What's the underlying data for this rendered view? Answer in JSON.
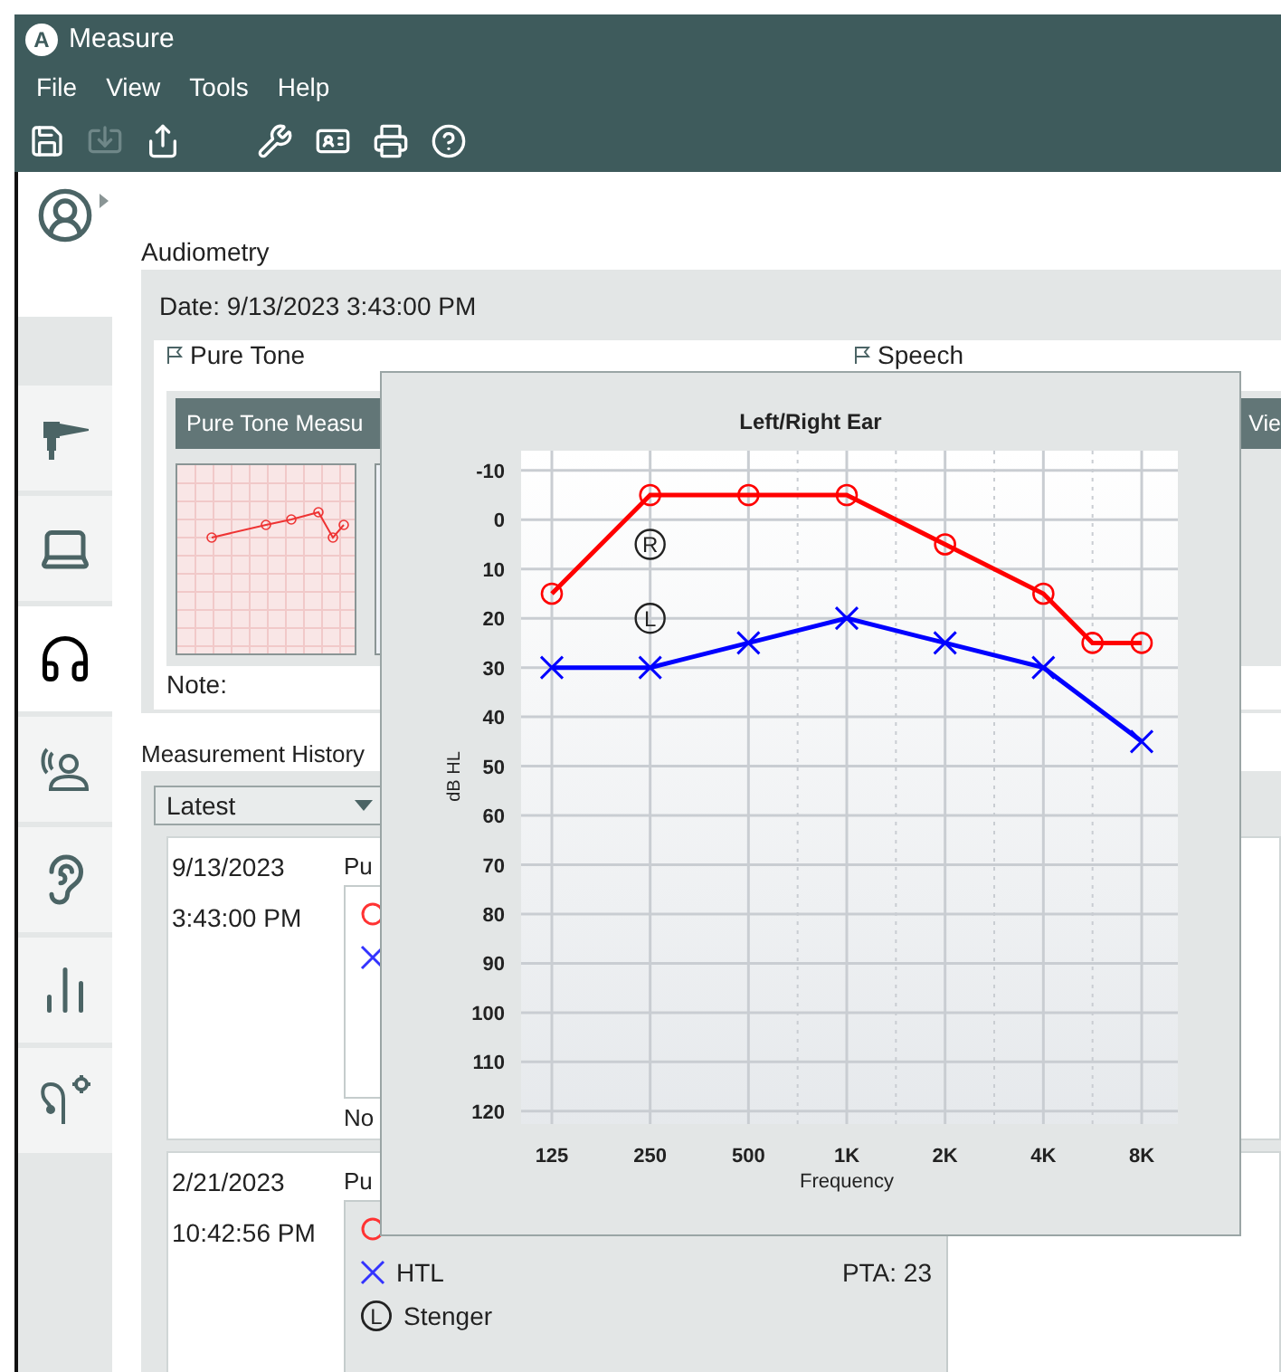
{
  "window": {
    "title": "Measure",
    "logo": "A"
  },
  "menu": [
    "File",
    "View",
    "Tools",
    "Help"
  ],
  "toolbar": [
    {
      "disabled": false
    },
    {
      "disabled": true
    },
    {
      "disabled": false
    },
    {
      "disabled": false
    },
    {
      "disabled": false
    },
    {
      "disabled": false
    },
    {
      "disabled": false
    }
  ],
  "sidebar": {
    "items": [
      {
        "selected": false
      },
      {
        "selected": false
      },
      {
        "selected": true
      },
      {
        "selected": false
      },
      {
        "selected": false
      },
      {
        "selected": false
      },
      {
        "selected": false
      }
    ]
  },
  "audiometry": {
    "heading": "Audiometry",
    "date": "Date: 9/13/2023 3:43:00 PM",
    "sections": [
      {
        "label": "Pure Tone"
      },
      {
        "label": "Speech"
      }
    ],
    "header": "Pure Tone Measu",
    "header_right": "Vie",
    "note": "Note:"
  },
  "history": {
    "heading": "Measurement History",
    "filter": "Latest",
    "cards": [
      {
        "date": "9/13/2023",
        "time": "3:43:00 PM",
        "title": "Pu",
        "note": "No",
        "entries": [
          {
            "kind": "circle",
            "color": "#ff3333"
          },
          {
            "kind": "cross",
            "color": "#3333ff"
          }
        ]
      },
      {
        "date": "2/21/2023",
        "time": "10:42:56 PM",
        "title": "Pu",
        "entries": [
          {
            "kind": "circle",
            "color": "#ff3333"
          },
          {
            "kind": "cross",
            "color": "#3333ff",
            "label": "HTL",
            "value": "PTA: 23"
          },
          {
            "kind": "letter",
            "mark": "L",
            "color": "#222222",
            "label": "Stenger"
          }
        ]
      }
    ]
  },
  "popup": {
    "chart_data": {
      "type": "line",
      "title": "Left/Right Ear",
      "xlabel": "Frequency",
      "ylabel": "dB HL",
      "categories": [
        "125",
        null,
        "250",
        null,
        "500",
        null,
        "1K",
        null,
        "2K",
        null,
        "4K",
        null,
        "8K"
      ],
      "series": [
        {
          "color": "#ff0000",
          "marker": "circle",
          "values": [
            15,
            null,
            -5,
            null,
            -5,
            null,
            -5,
            null,
            5,
            null,
            15,
            25,
            25
          ]
        },
        {
          "color": "#0000ff",
          "marker": "cross",
          "values": [
            30,
            null,
            30,
            null,
            25,
            null,
            20,
            null,
            25,
            null,
            30,
            null,
            45
          ]
        }
      ],
      "ylim": [
        122.6,
        -14
      ],
      "yticks": [
        -10,
        0,
        10,
        20,
        30,
        40,
        50,
        60,
        70,
        80,
        90,
        100,
        110,
        120
      ],
      "grid": true,
      "annotations": [
        {
          "x": "250",
          "y": 5,
          "text": "R"
        },
        {
          "x": "250",
          "y": 20,
          "text": "L"
        }
      ]
    }
  }
}
